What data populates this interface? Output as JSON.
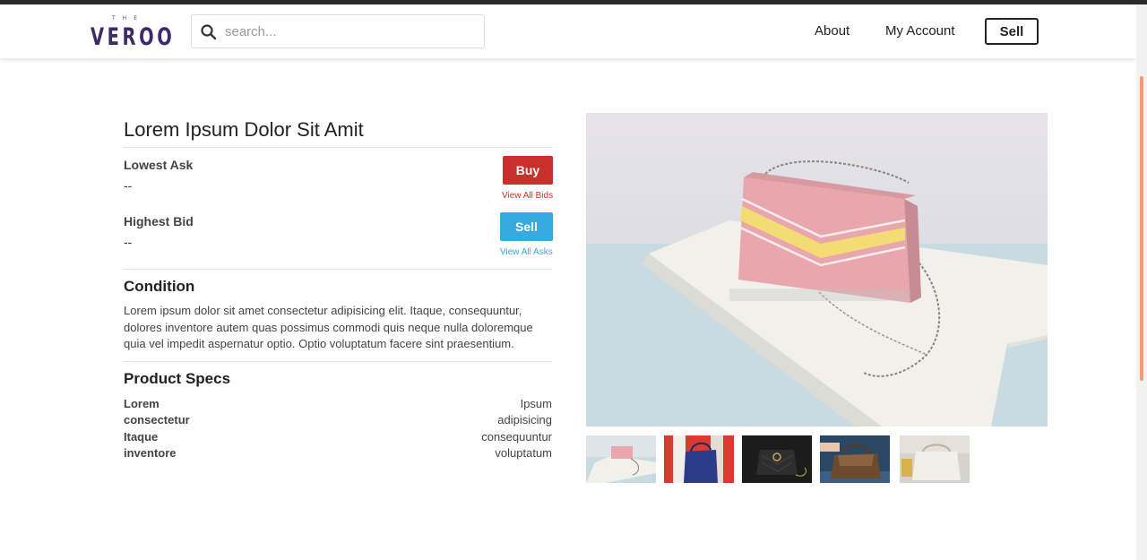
{
  "header": {
    "logo_small": "THE",
    "logo_text": "VEROO",
    "search_placeholder": "search...",
    "nav": {
      "about": "About",
      "account": "My Account",
      "sell": "Sell"
    }
  },
  "product": {
    "title": "Lorem Ipsum Dolor Sit Amit",
    "lowest_ask_label": "Lowest Ask",
    "lowest_ask_value": "--",
    "highest_bid_label": "Highest Bid",
    "highest_bid_value": "--",
    "buy_label": "Buy",
    "view_bids": "View All Bids",
    "sell_label": "Sell",
    "view_asks": "View All Asks",
    "condition_heading": "Condition",
    "condition_text": "Lorem ipsum dolor sit amet consectetur adipisicing elit. Itaque, consequuntur, dolores inventore autem quas possimus commodi quis neque nulla doloremque quia vel impedit aspernatur optio. Optio voluptatum facere sint praesentium.",
    "specs_heading": "Product Specs",
    "specs": [
      {
        "key": "Lorem",
        "value": "Ipsum"
      },
      {
        "key": "consectetur",
        "value": "adipisicing"
      },
      {
        "key": "Itaque",
        "value": "consequuntur"
      },
      {
        "key": "inventore",
        "value": "voluptatum"
      }
    ]
  },
  "colors": {
    "buy": "#c9302c",
    "sell": "#36a9df",
    "brand": "#3d2a6b"
  }
}
